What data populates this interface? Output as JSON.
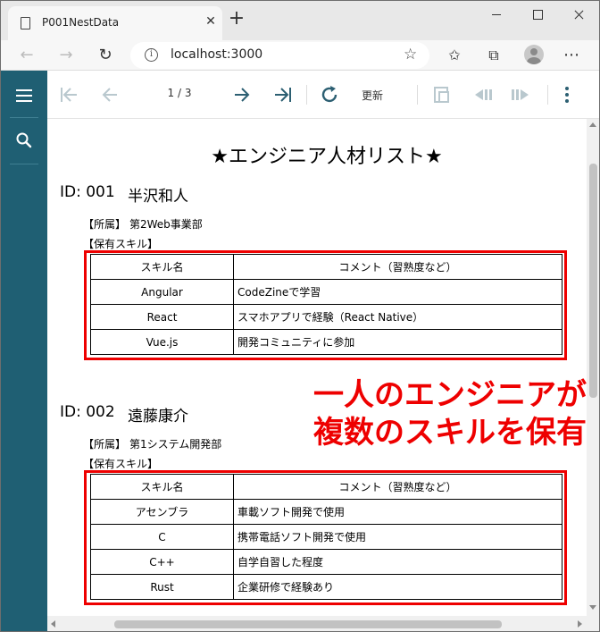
{
  "browser": {
    "tab_title": "P001NestData",
    "url": "localhost:3000"
  },
  "viewer": {
    "page_indicator": "1 / 3",
    "update_label": "更新"
  },
  "report": {
    "title": "★エンジニア人材リスト★",
    "dept_label": "【所属】",
    "skill_label": "【保有スキル】",
    "table_headers": [
      "スキル名",
      "コメント（習熟度など）"
    ],
    "engineers": [
      {
        "id": "ID: 001",
        "name": "半沢和人",
        "dept": "第2Web事業部",
        "skills": [
          {
            "name": "Angular",
            "comment": "CodeZineで学習"
          },
          {
            "name": "React",
            "comment": "スマホアプリで経験（React Native）"
          },
          {
            "name": "Vue.js",
            "comment": "開発コミュニティに参加"
          }
        ]
      },
      {
        "id": "ID: 002",
        "name": "遠藤康介",
        "dept": "第1システム開発部",
        "skills": [
          {
            "name": "アセンブラ",
            "comment": "車載ソフト開発で使用"
          },
          {
            "name": "C",
            "comment": "携帯電話ソフト開発で使用"
          },
          {
            "name": "C++",
            "comment": "自学自習した程度"
          },
          {
            "name": "Rust",
            "comment": "企業研修で経験あり"
          }
        ]
      }
    ]
  },
  "annotation": {
    "line1": "一人のエンジニアが",
    "line2": "複数のスキルを保有"
  },
  "colors": {
    "sidebar": "#1f5f73",
    "toolbar_icon": "#2c5f72",
    "highlight_red": "#ee0000"
  }
}
